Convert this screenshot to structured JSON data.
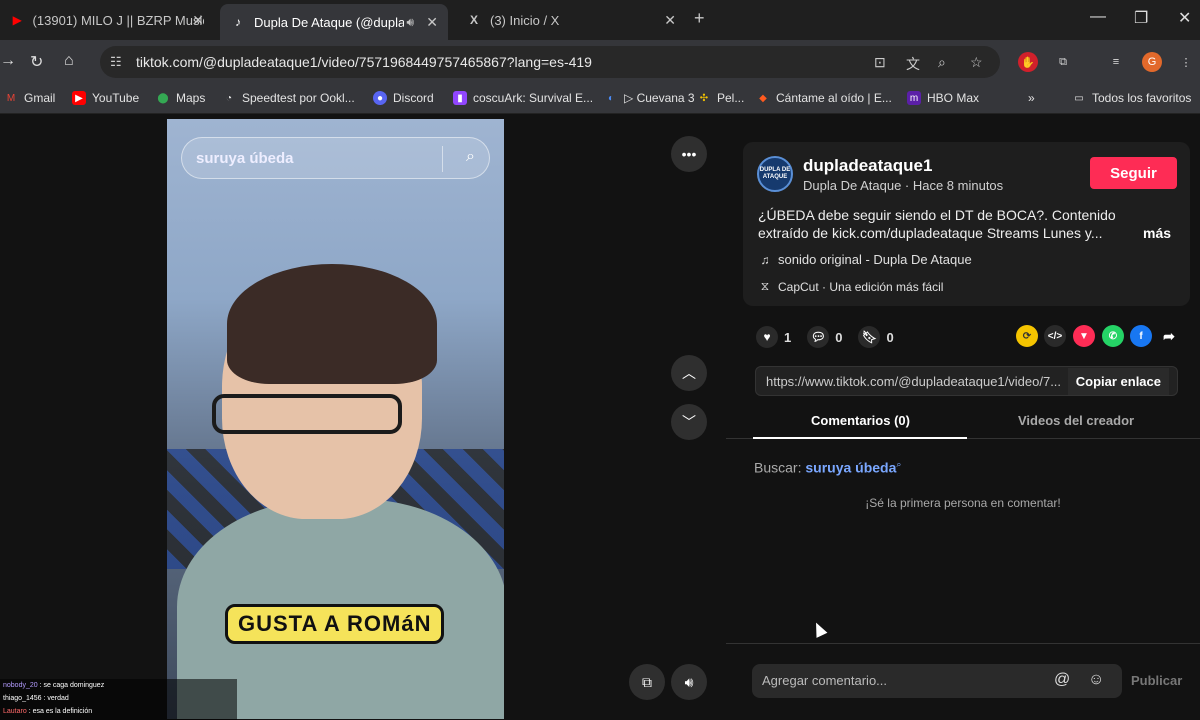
{
  "browser": {
    "tabs": [
      {
        "title": "(13901) MILO J || BZRP Music S",
        "icon": "youtube-icon",
        "active": false
      },
      {
        "title": "Dupla De Ataque (@duplad",
        "icon": "tiktok-icon",
        "active": true
      },
      {
        "title": "(3) Inicio / X",
        "icon": "x-icon",
        "active": false
      }
    ],
    "url": "tiktok.com/@dupladeataque1/video/7571968449757465867?lang=es-419",
    "profile_initial": "G",
    "bookmarks": [
      "Gmail",
      "YouTube",
      "Maps",
      "Speedtest por Ookl...",
      "Discord",
      "coscuArk: Survival E...",
      "▷ Cuevana 3",
      "Pel...",
      "Cántame al oído | E...",
      "HBO Max"
    ],
    "all_bookmarks": "Todos los favoritos"
  },
  "video": {
    "search_query": "suruya úbeda",
    "caption": "GUSTA A ROMáN"
  },
  "chat": [
    {
      "user": "nobody_20",
      "text": " : se caga dominguez"
    },
    {
      "user": "thiago_1456",
      "text": " : verdad"
    },
    {
      "user": "Lautaro",
      "text": " : esa es la definición"
    }
  ],
  "post": {
    "avatar_text": "DUPLA DE ATAQUE",
    "username": "dupladeataque1",
    "subline": "Dupla De Ataque · Hace 8 minutos",
    "follow": "Seguir",
    "description": "¿ÚBEDA debe seguir siendo el DT de BOCA?. Contenido extraído de kick.com/dupladeataque Streams Lunes y...",
    "more": "más",
    "music": "sonido original - Dupla De Ataque",
    "capcut": "CapCut · Una edición más fácil",
    "likes": "1",
    "comments": "0",
    "saves": "0",
    "link": "https://www.tiktok.com/@dupladeataque1/video/7...",
    "copy_link": "Copiar enlace",
    "tab_comments": "Comentarios (0)",
    "tab_creator": "Videos del creador",
    "search_label": "Buscar:",
    "search_term": "suruya úbeda",
    "empty_text": "¡Sé la primera persona en comentar!",
    "comment_placeholder": "Agregar comentario...",
    "publish": "Publicar"
  },
  "colors": {
    "follow": "#fe2c55",
    "search_term": "#7aa7ff"
  }
}
